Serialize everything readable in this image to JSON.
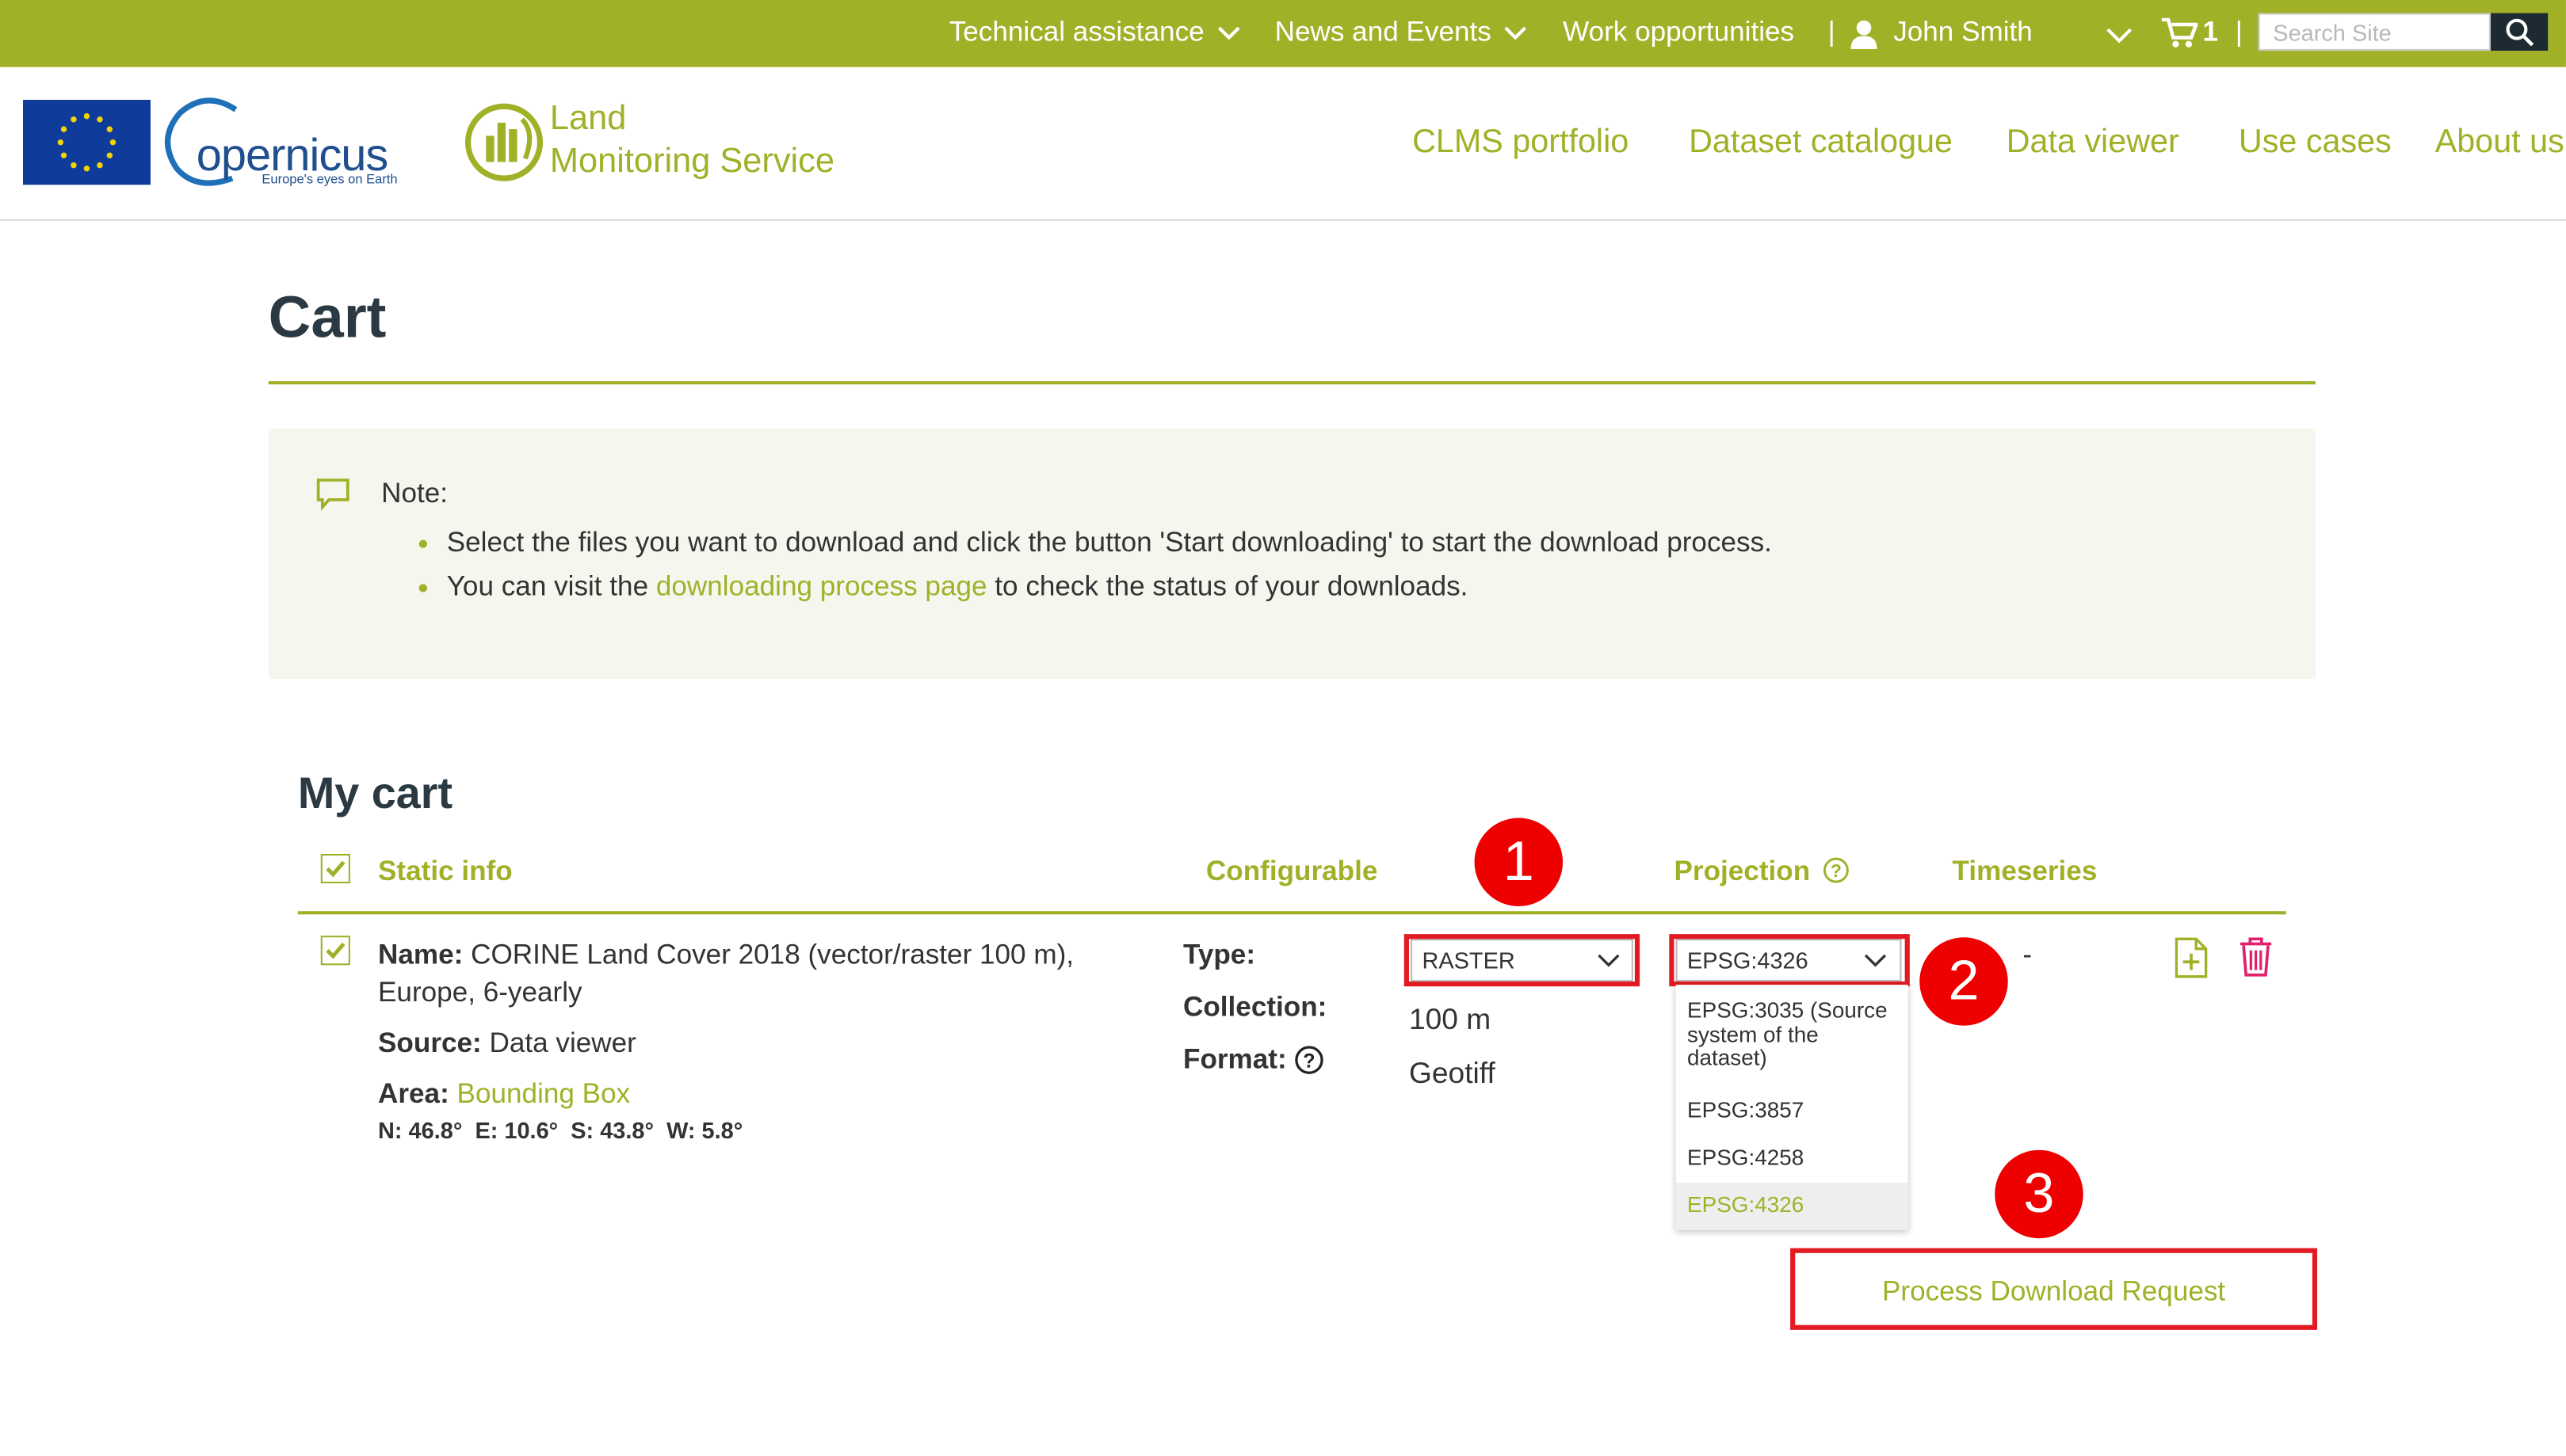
{
  "topbar": {
    "technical_assistance": "Technical assistance",
    "news_events": "News and Events",
    "work_opportunities": "Work opportunities",
    "separator": "|",
    "user_name": "John Smith",
    "cart_count": "1",
    "search_placeholder": "Search Site"
  },
  "header": {
    "copernicus_text": "opernicus",
    "copernicus_tagline": "Europe's eyes on Earth",
    "lms_line1": "Land",
    "lms_line2": "Monitoring Service",
    "nav": [
      "CLMS portfolio",
      "Dataset catalogue",
      "Data viewer",
      "Use cases",
      "About us"
    ]
  },
  "page": {
    "title": "Cart",
    "note_label": "Note:",
    "note_line1": "Select the files you want to download and click the button 'Start downloading' to start the download process.",
    "note_line2_pre": "You can visit the ",
    "note_line2_link": "downloading process page",
    "note_line2_post": " to check the status of your downloads."
  },
  "cart": {
    "heading": "My cart",
    "columns": {
      "static_info": "Static info",
      "configurable": "Configurable",
      "projection": "Projection",
      "timeseries": "Timeseries"
    },
    "item": {
      "name_label": "Name:",
      "name_value_line1": "CORINE Land Cover 2018 (vector/raster 100 m),",
      "name_value_line2": "Europe, 6-yearly",
      "source_label": "Source:",
      "source_value": "Data viewer",
      "area_label": "Area:",
      "area_link": "Bounding Box",
      "coords": "N: 46.8°  E: 10.6°  S: 43.8°  W: 5.8°",
      "type_label": "Type:",
      "collection_label": "Collection:",
      "format_label": "Format:",
      "type_value": "RASTER",
      "collection_value": "100 m",
      "format_value": "Geotiff",
      "projection_value": "EPSG:4326",
      "timeseries_value": "-",
      "projection_options": [
        "EPSG:3035 (Source",
        "system of the",
        "dataset)",
        "EPSG:3857",
        "EPSG:4258",
        "EPSG:4326"
      ]
    },
    "process_button": "Process Download Request"
  },
  "annotations": [
    "1",
    "2",
    "3"
  ],
  "colors": {
    "brand_green": "#a0b128",
    "annotation_red": "#e21b23",
    "dark": "#2b3a42"
  }
}
